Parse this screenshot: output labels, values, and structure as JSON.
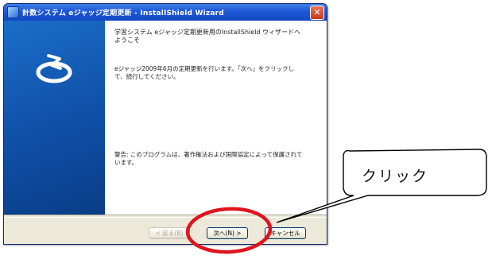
{
  "window": {
    "title": "計数システム eジャッジ定期更新 - InstallShield Wizard",
    "close_glyph": "✕"
  },
  "content": {
    "heading": "学習システム eジャッジ定期更新用のInstallShield ウィザードへようこそ",
    "body": "eジャッジ2009年6月の定期更新を行います。「次へ」をクリックして、続行してください。",
    "warning": "警告: このプログラムは、著作権法および国際協定によって保護されています。"
  },
  "buttons": {
    "back": "< 戻る(B)",
    "next": "次へ(N) >",
    "cancel": "キャンセル"
  },
  "annotation": {
    "callout_text": "クリック",
    "highlight_color": "#e0141e"
  },
  "icons": {
    "title": "installer-icon",
    "logo": "installshield-logo-icon"
  },
  "colors": {
    "titlebar": "#1d57d6",
    "banner": "#0f4fa7",
    "highlight": "#e0141e"
  }
}
